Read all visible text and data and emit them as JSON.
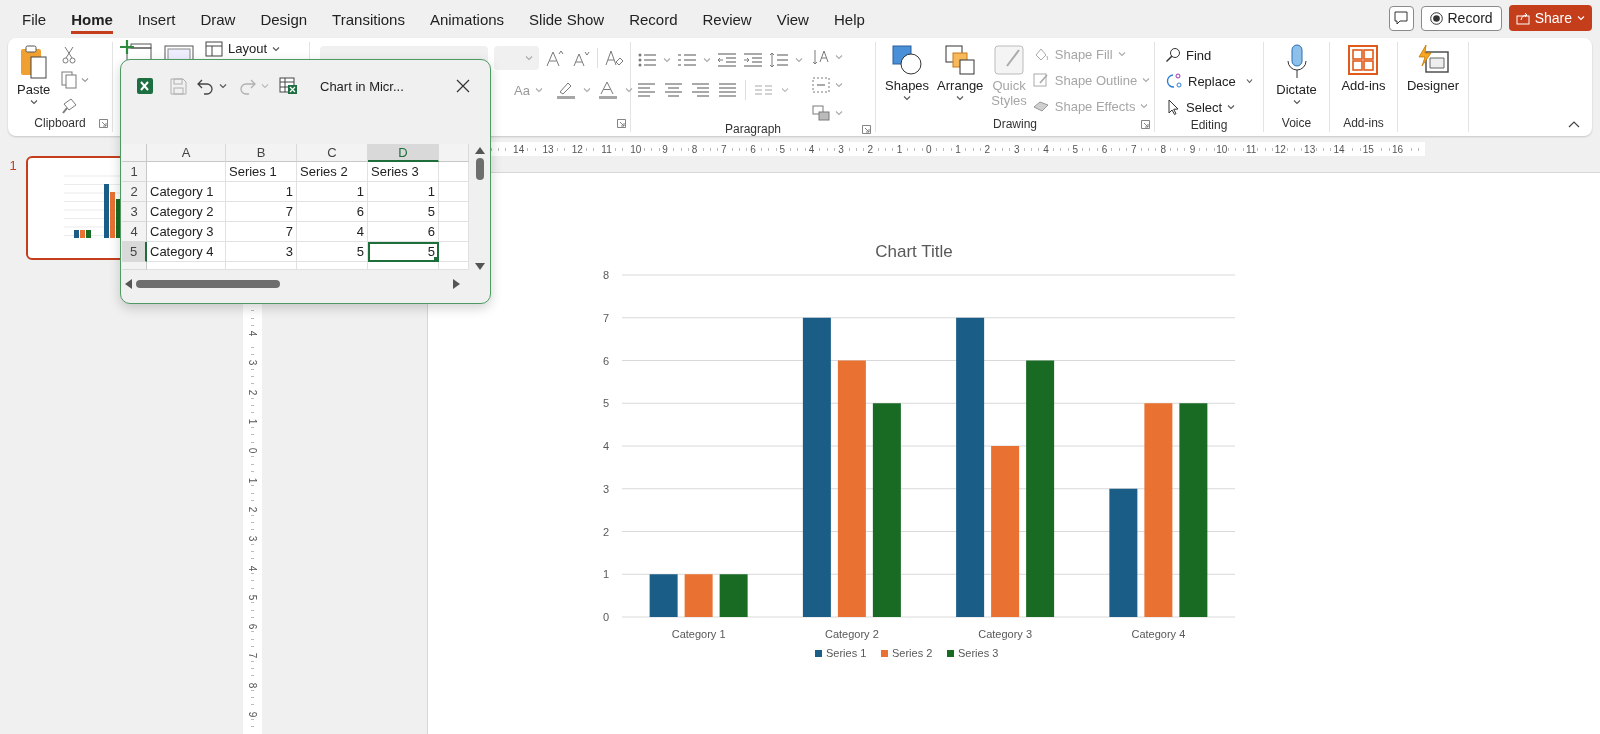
{
  "menu": {
    "tabs": [
      {
        "label": "File",
        "selected": false
      },
      {
        "label": "Home",
        "selected": true
      },
      {
        "label": "Insert",
        "selected": false
      },
      {
        "label": "Draw",
        "selected": false
      },
      {
        "label": "Design",
        "selected": false
      },
      {
        "label": "Transitions",
        "selected": false
      },
      {
        "label": "Animations",
        "selected": false
      },
      {
        "label": "Slide Show",
        "selected": false
      },
      {
        "label": "Record",
        "selected": false
      },
      {
        "label": "Review",
        "selected": false
      },
      {
        "label": "View",
        "selected": false
      },
      {
        "label": "Help",
        "selected": false
      }
    ]
  },
  "actions": {
    "record": "Record",
    "share": "Share"
  },
  "ribbon": {
    "clipboard": {
      "label": "Clipboard",
      "paste": "Paste"
    },
    "slides": {
      "layout": "Layout"
    },
    "font": {
      "change_case": "Aa"
    },
    "paragraph": {
      "label": "Paragraph"
    },
    "drawing": {
      "label": "Drawing",
      "shapes": "Shapes",
      "arrange": "Arrange",
      "quick_styles": {
        "label": "Quick Styles",
        "disabled": true
      },
      "shape_commands": [
        {
          "label": "Shape Fill",
          "disabled": true
        },
        {
          "label": "Shape Outline",
          "disabled": true
        },
        {
          "label": "Shape Effects",
          "disabled": true
        }
      ]
    },
    "editing": {
      "label": "Editing",
      "find": "Find",
      "replace": "Replace",
      "select": "Select"
    },
    "voice": {
      "label": "Voice",
      "dictate": "Dictate"
    },
    "addins": {
      "label": "Add-ins",
      "button": "Add-ins"
    },
    "designer": {
      "button": "Designer"
    }
  },
  "thumbnails": [
    {
      "number": "1",
      "selected": true
    }
  ],
  "rulers": {
    "horizontal": [
      "14",
      "13",
      "12",
      "11",
      "10",
      "9",
      "8",
      "7",
      "6",
      "5",
      "4",
      "3",
      "2",
      "1",
      "0",
      "1",
      "2",
      "3",
      "4",
      "5",
      "6",
      "7",
      "8",
      "9",
      "10",
      "11",
      "12",
      "13",
      "14",
      "15",
      "16"
    ],
    "vertical": [
      "4",
      "3",
      "2",
      "1",
      "0",
      "1",
      "2",
      "3",
      "4",
      "5",
      "6",
      "7",
      "8",
      "9"
    ]
  },
  "chart_window": {
    "title": "Chart in Micr...",
    "save_disabled": true,
    "redo_disabled": true,
    "columns": [
      {
        "label": "A",
        "selected": false
      },
      {
        "label": "B",
        "selected": false
      },
      {
        "label": "C",
        "selected": false
      },
      {
        "label": "D",
        "selected": true
      }
    ],
    "rows": [
      {
        "header": "1",
        "selected": false,
        "cells": [
          {
            "selected": false
          },
          {
            "text": "Series 1",
            "selected": false
          },
          {
            "text": "Series 2",
            "selected": false
          },
          {
            "text": "Series 3",
            "selected": false
          }
        ]
      },
      {
        "header": "2",
        "selected": false,
        "cells": [
          {
            "text": "Category 1",
            "selected": false
          },
          {
            "text": "1",
            "selected": false
          },
          {
            "text": "1",
            "selected": false
          },
          {
            "text": "1",
            "selected": false
          }
        ]
      },
      {
        "header": "3",
        "selected": false,
        "cells": [
          {
            "text": "Category 2",
            "selected": false
          },
          {
            "text": "7",
            "selected": false
          },
          {
            "text": "6",
            "selected": false
          },
          {
            "text": "5",
            "selected": false
          }
        ]
      },
      {
        "header": "4",
        "selected": false,
        "cells": [
          {
            "text": "Category 3",
            "selected": false
          },
          {
            "text": "7",
            "selected": false
          },
          {
            "text": "4",
            "selected": false
          },
          {
            "text": "6",
            "selected": false
          }
        ]
      },
      {
        "header": "5",
        "selected": true,
        "cells": [
          {
            "text": "Category 4",
            "selected": false
          },
          {
            "text": "3",
            "selected": false
          },
          {
            "text": "5",
            "selected": false
          },
          {
            "text": "5",
            "selected": true
          }
        ]
      }
    ]
  },
  "slide": {
    "chart_data": {
      "type": "bar",
      "title": "Chart Title",
      "categories": [
        "Category 1",
        "Category 2",
        "Category 3",
        "Category 4"
      ],
      "series": [
        {
          "name": "Series 1",
          "color": "#1a5d86",
          "values": [
            1,
            7,
            7,
            3
          ]
        },
        {
          "name": "Series 2",
          "color": "#e97132",
          "values": [
            1,
            6,
            4,
            5
          ]
        },
        {
          "name": "Series 3",
          "color": "#196b24",
          "values": [
            1,
            5,
            6,
            5
          ]
        }
      ],
      "ylim": [
        0,
        8
      ],
      "yticks": [
        0,
        1,
        2,
        3,
        4,
        5,
        6,
        7,
        8
      ],
      "grid": true,
      "legend": true
    }
  }
}
